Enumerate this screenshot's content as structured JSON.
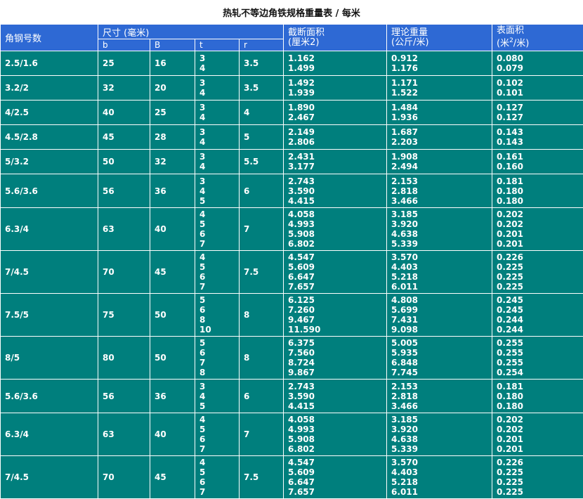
{
  "title": "热轧不等边角铁规格重量表 / 每米",
  "headers": {
    "model": "角钢号数",
    "size_group": "尺寸 (毫米)",
    "b": "b",
    "B": "B",
    "t": "t",
    "r": "r",
    "area": [
      "截断面积",
      "(厘米2)"
    ],
    "weight": [
      "理论重量",
      "(公斤/米)"
    ],
    "surface_line1": "表面积",
    "surface_line2_pre": "(米",
    "surface_sup": "2",
    "surface_line2_post": "/米)"
  },
  "colors": {
    "header_bg": "#2e69d4",
    "body_bg": "#007f7d",
    "text": "#ffffff"
  },
  "rows": [
    {
      "model": "2.5/1.6",
      "b": "25",
      "B": "16",
      "t": [
        "3",
        "4"
      ],
      "r": "3.5",
      "area": [
        "1.162",
        "1.499"
      ],
      "weight": [
        "0.912",
        "1.176"
      ],
      "surface": [
        "0.080",
        "0.079"
      ]
    },
    {
      "model": "3.2/2",
      "b": "32",
      "B": "20",
      "t": [
        "3",
        "4"
      ],
      "r": "3.5",
      "area": [
        "1.492",
        "1.939"
      ],
      "weight": [
        "1.171",
        "1.522"
      ],
      "surface": [
        "0.102",
        "0.101"
      ]
    },
    {
      "model": "4/2.5",
      "b": "40",
      "B": "25",
      "t": [
        "3",
        "4"
      ],
      "r": "4",
      "area": [
        "1.890",
        "2.467"
      ],
      "weight": [
        "1.484",
        "1.936"
      ],
      "surface": [
        "0.127",
        "0.127"
      ]
    },
    {
      "model": "4.5/2.8",
      "b": "45",
      "B": "28",
      "t": [
        "3",
        "4"
      ],
      "r": "5",
      "area": [
        "2.149",
        "2.806"
      ],
      "weight": [
        "1.687",
        "2.203"
      ],
      "surface": [
        "0.143",
        "0.143"
      ]
    },
    {
      "model": "5/3.2",
      "b": "50",
      "B": "32",
      "t": [
        "3",
        "4"
      ],
      "r": "5.5",
      "area": [
        "2.431",
        "3.177"
      ],
      "weight": [
        "1.908",
        "2.494"
      ],
      "surface": [
        "0.161",
        "0.160"
      ]
    },
    {
      "model": "5.6/3.6",
      "b": "56",
      "B": "36",
      "t": [
        "3",
        "4",
        "5"
      ],
      "r": "6",
      "area": [
        "2.743",
        "3.590",
        "4.415"
      ],
      "weight": [
        "2.153",
        "2.818",
        "3.466"
      ],
      "surface": [
        "0.181",
        "0.180",
        "0.180"
      ]
    },
    {
      "model": "6.3/4",
      "b": "63",
      "B": "40",
      "t": [
        "4",
        "5",
        "6",
        "7"
      ],
      "r": "7",
      "area": [
        "4.058",
        "4.993",
        "5.908",
        "6.802"
      ],
      "weight": [
        "3.185",
        "3.920",
        "4.638",
        "5.339"
      ],
      "surface": [
        "0.202",
        "0.202",
        "0.201",
        "0.201"
      ]
    },
    {
      "model": "7/4.5",
      "b": "70",
      "B": "45",
      "t": [
        "4",
        "5",
        "6",
        "7"
      ],
      "r": "7.5",
      "area": [
        "4.547",
        "5.609",
        "6.647",
        "7.657"
      ],
      "weight": [
        "3.570",
        "4.403",
        "5.218",
        "6.011"
      ],
      "surface": [
        "0.226",
        "0.225",
        "0.225",
        "0.225"
      ]
    },
    {
      "model": "7.5/5",
      "b": "75",
      "B": "50",
      "t": [
        "5",
        "6",
        "8",
        "10"
      ],
      "r": "8",
      "area": [
        "6.125",
        "7.260",
        "9.467",
        "11.590"
      ],
      "weight": [
        "4.808",
        "5.699",
        "7.431",
        "9.098"
      ],
      "surface": [
        "0.245",
        "0.245",
        "0.244",
        "0.244"
      ]
    },
    {
      "model": "8/5",
      "b": "80",
      "B": "50",
      "t": [
        "5",
        "6",
        "7",
        "8"
      ],
      "r": "8",
      "area": [
        "6.375",
        "7.560",
        "8.724",
        "9.867"
      ],
      "weight": [
        "5.005",
        "5.935",
        "6.848",
        "7.745"
      ],
      "surface": [
        "0.255",
        "0.255",
        "0.255",
        "0.254"
      ]
    },
    {
      "model": "5.6/3.6",
      "b": "56",
      "B": "36",
      "t": [
        "3",
        "4",
        "5"
      ],
      "r": "6",
      "area": [
        "2.743",
        "3.590",
        "4.415"
      ],
      "weight": [
        "2.153",
        "2.818",
        "3.466"
      ],
      "surface": [
        "0.181",
        "0.180",
        "0.180"
      ]
    },
    {
      "model": "6.3/4",
      "b": "63",
      "B": "40",
      "t": [
        "4",
        "5",
        "6",
        "7"
      ],
      "r": "7",
      "area": [
        "4.058",
        "4.993",
        "5.908",
        "6.802"
      ],
      "weight": [
        "3.185",
        "3.920",
        "4.638",
        "5.339"
      ],
      "surface": [
        "0.202",
        "0.202",
        "0.201",
        "0.201"
      ]
    },
    {
      "model": "7/4.5",
      "b": "70",
      "B": "45",
      "t": [
        "4",
        "5",
        "6",
        "7"
      ],
      "r": "7.5",
      "area": [
        "4.547",
        "5.609",
        "6.647",
        "7.657"
      ],
      "weight": [
        "3.570",
        "4.403",
        "5.218",
        "6.011"
      ],
      "surface": [
        "0.226",
        "0.225",
        "0.225",
        "0.225"
      ]
    }
  ]
}
